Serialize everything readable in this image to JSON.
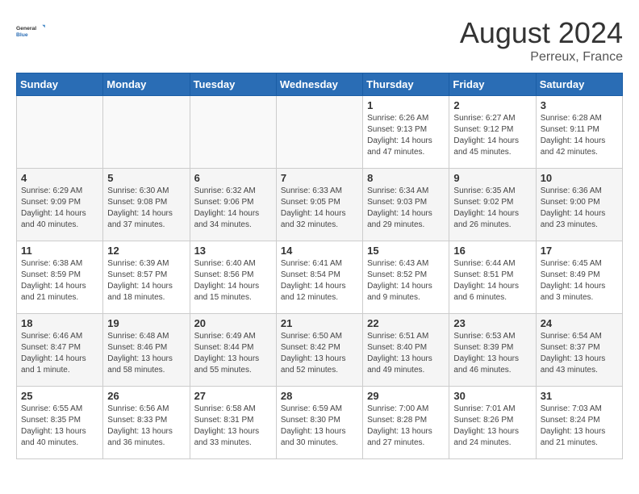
{
  "header": {
    "logo_general": "General",
    "logo_blue": "Blue",
    "month_year": "August 2024",
    "location": "Perreux, France"
  },
  "weekdays": [
    "Sunday",
    "Monday",
    "Tuesday",
    "Wednesday",
    "Thursday",
    "Friday",
    "Saturday"
  ],
  "weeks": [
    [
      {
        "day": "",
        "sunrise": "",
        "sunset": "",
        "daylight": ""
      },
      {
        "day": "",
        "sunrise": "",
        "sunset": "",
        "daylight": ""
      },
      {
        "day": "",
        "sunrise": "",
        "sunset": "",
        "daylight": ""
      },
      {
        "day": "",
        "sunrise": "",
        "sunset": "",
        "daylight": ""
      },
      {
        "day": "1",
        "sunrise": "Sunrise: 6:26 AM",
        "sunset": "Sunset: 9:13 PM",
        "daylight": "Daylight: 14 hours and 47 minutes."
      },
      {
        "day": "2",
        "sunrise": "Sunrise: 6:27 AM",
        "sunset": "Sunset: 9:12 PM",
        "daylight": "Daylight: 14 hours and 45 minutes."
      },
      {
        "day": "3",
        "sunrise": "Sunrise: 6:28 AM",
        "sunset": "Sunset: 9:11 PM",
        "daylight": "Daylight: 14 hours and 42 minutes."
      }
    ],
    [
      {
        "day": "4",
        "sunrise": "Sunrise: 6:29 AM",
        "sunset": "Sunset: 9:09 PM",
        "daylight": "Daylight: 14 hours and 40 minutes."
      },
      {
        "day": "5",
        "sunrise": "Sunrise: 6:30 AM",
        "sunset": "Sunset: 9:08 PM",
        "daylight": "Daylight: 14 hours and 37 minutes."
      },
      {
        "day": "6",
        "sunrise": "Sunrise: 6:32 AM",
        "sunset": "Sunset: 9:06 PM",
        "daylight": "Daylight: 14 hours and 34 minutes."
      },
      {
        "day": "7",
        "sunrise": "Sunrise: 6:33 AM",
        "sunset": "Sunset: 9:05 PM",
        "daylight": "Daylight: 14 hours and 32 minutes."
      },
      {
        "day": "8",
        "sunrise": "Sunrise: 6:34 AM",
        "sunset": "Sunset: 9:03 PM",
        "daylight": "Daylight: 14 hours and 29 minutes."
      },
      {
        "day": "9",
        "sunrise": "Sunrise: 6:35 AM",
        "sunset": "Sunset: 9:02 PM",
        "daylight": "Daylight: 14 hours and 26 minutes."
      },
      {
        "day": "10",
        "sunrise": "Sunrise: 6:36 AM",
        "sunset": "Sunset: 9:00 PM",
        "daylight": "Daylight: 14 hours and 23 minutes."
      }
    ],
    [
      {
        "day": "11",
        "sunrise": "Sunrise: 6:38 AM",
        "sunset": "Sunset: 8:59 PM",
        "daylight": "Daylight: 14 hours and 21 minutes."
      },
      {
        "day": "12",
        "sunrise": "Sunrise: 6:39 AM",
        "sunset": "Sunset: 8:57 PM",
        "daylight": "Daylight: 14 hours and 18 minutes."
      },
      {
        "day": "13",
        "sunrise": "Sunrise: 6:40 AM",
        "sunset": "Sunset: 8:56 PM",
        "daylight": "Daylight: 14 hours and 15 minutes."
      },
      {
        "day": "14",
        "sunrise": "Sunrise: 6:41 AM",
        "sunset": "Sunset: 8:54 PM",
        "daylight": "Daylight: 14 hours and 12 minutes."
      },
      {
        "day": "15",
        "sunrise": "Sunrise: 6:43 AM",
        "sunset": "Sunset: 8:52 PM",
        "daylight": "Daylight: 14 hours and 9 minutes."
      },
      {
        "day": "16",
        "sunrise": "Sunrise: 6:44 AM",
        "sunset": "Sunset: 8:51 PM",
        "daylight": "Daylight: 14 hours and 6 minutes."
      },
      {
        "day": "17",
        "sunrise": "Sunrise: 6:45 AM",
        "sunset": "Sunset: 8:49 PM",
        "daylight": "Daylight: 14 hours and 3 minutes."
      }
    ],
    [
      {
        "day": "18",
        "sunrise": "Sunrise: 6:46 AM",
        "sunset": "Sunset: 8:47 PM",
        "daylight": "Daylight: 14 hours and 1 minute."
      },
      {
        "day": "19",
        "sunrise": "Sunrise: 6:48 AM",
        "sunset": "Sunset: 8:46 PM",
        "daylight": "Daylight: 13 hours and 58 minutes."
      },
      {
        "day": "20",
        "sunrise": "Sunrise: 6:49 AM",
        "sunset": "Sunset: 8:44 PM",
        "daylight": "Daylight: 13 hours and 55 minutes."
      },
      {
        "day": "21",
        "sunrise": "Sunrise: 6:50 AM",
        "sunset": "Sunset: 8:42 PM",
        "daylight": "Daylight: 13 hours and 52 minutes."
      },
      {
        "day": "22",
        "sunrise": "Sunrise: 6:51 AM",
        "sunset": "Sunset: 8:40 PM",
        "daylight": "Daylight: 13 hours and 49 minutes."
      },
      {
        "day": "23",
        "sunrise": "Sunrise: 6:53 AM",
        "sunset": "Sunset: 8:39 PM",
        "daylight": "Daylight: 13 hours and 46 minutes."
      },
      {
        "day": "24",
        "sunrise": "Sunrise: 6:54 AM",
        "sunset": "Sunset: 8:37 PM",
        "daylight": "Daylight: 13 hours and 43 minutes."
      }
    ],
    [
      {
        "day": "25",
        "sunrise": "Sunrise: 6:55 AM",
        "sunset": "Sunset: 8:35 PM",
        "daylight": "Daylight: 13 hours and 40 minutes."
      },
      {
        "day": "26",
        "sunrise": "Sunrise: 6:56 AM",
        "sunset": "Sunset: 8:33 PM",
        "daylight": "Daylight: 13 hours and 36 minutes."
      },
      {
        "day": "27",
        "sunrise": "Sunrise: 6:58 AM",
        "sunset": "Sunset: 8:31 PM",
        "daylight": "Daylight: 13 hours and 33 minutes."
      },
      {
        "day": "28",
        "sunrise": "Sunrise: 6:59 AM",
        "sunset": "Sunset: 8:30 PM",
        "daylight": "Daylight: 13 hours and 30 minutes."
      },
      {
        "day": "29",
        "sunrise": "Sunrise: 7:00 AM",
        "sunset": "Sunset: 8:28 PM",
        "daylight": "Daylight: 13 hours and 27 minutes."
      },
      {
        "day": "30",
        "sunrise": "Sunrise: 7:01 AM",
        "sunset": "Sunset: 8:26 PM",
        "daylight": "Daylight: 13 hours and 24 minutes."
      },
      {
        "day": "31",
        "sunrise": "Sunrise: 7:03 AM",
        "sunset": "Sunset: 8:24 PM",
        "daylight": "Daylight: 13 hours and 21 minutes."
      }
    ]
  ]
}
